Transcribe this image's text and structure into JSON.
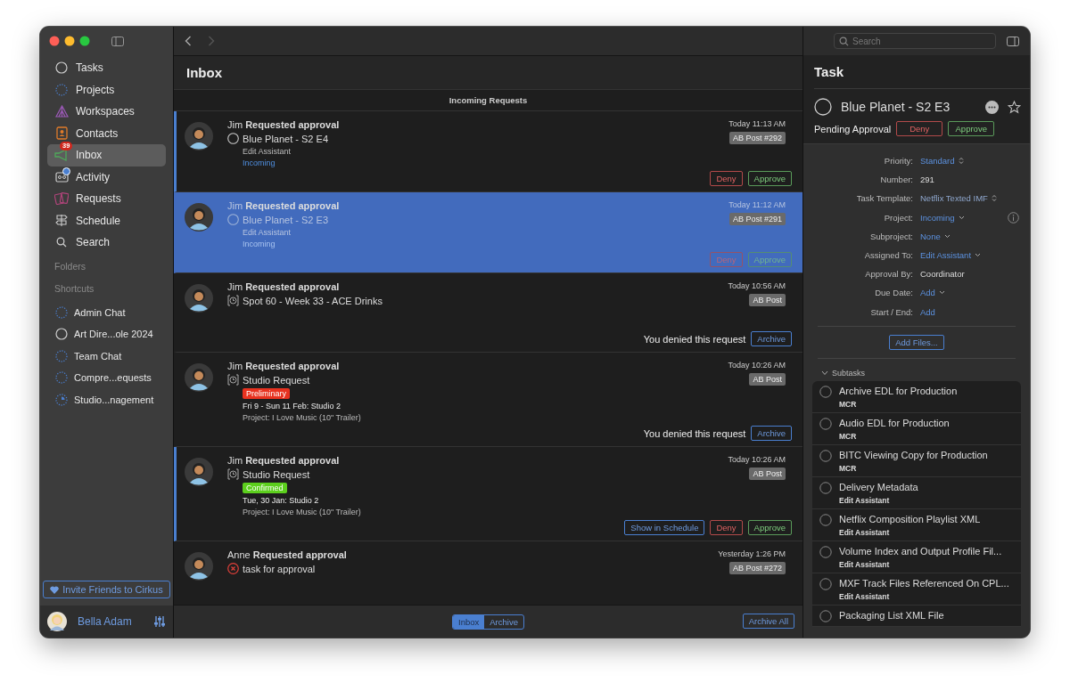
{
  "sidebar": {
    "nav": [
      {
        "label": "Tasks",
        "kind": "circle",
        "selected": false,
        "unread_dot": false
      },
      {
        "label": "Projects",
        "kind": "dotted",
        "selected": false,
        "unread_dot": false
      },
      {
        "label": "Workspaces",
        "kind": "tent",
        "selected": false,
        "unread_dot": false
      },
      {
        "label": "Contacts",
        "kind": "contacts",
        "selected": false,
        "unread_dot": false
      },
      {
        "label": "Inbox",
        "kind": "megaphone",
        "selected": true,
        "unread_dot": false,
        "badge": "39"
      },
      {
        "label": "Activity",
        "kind": "cassette",
        "selected": false,
        "unread_dot": true
      },
      {
        "label": "Requests",
        "kind": "cards",
        "selected": false,
        "unread_dot": false
      },
      {
        "label": "Schedule",
        "kind": "signpost",
        "selected": false,
        "unread_dot": false
      },
      {
        "label": "Search",
        "kind": "search",
        "selected": false,
        "unread_dot": false
      }
    ],
    "sections": [
      "Folders",
      "Shortcuts"
    ],
    "shortcuts": [
      {
        "label": "Admin Chat",
        "kind": "dotted"
      },
      {
        "label": "Art Dire...ole 2024",
        "kind": "circle"
      },
      {
        "label": "Team Chat",
        "kind": "dotted"
      },
      {
        "label": "Compre...equests",
        "kind": "dotted"
      },
      {
        "label": "Studio...nagement",
        "kind": "pie"
      }
    ],
    "invite_button": "Invite Friends to Cirkus",
    "user": {
      "name": "Bella Adam"
    }
  },
  "inbox": {
    "title": "Inbox",
    "section": "Incoming Requests",
    "items": [
      {
        "author": "Jim **Requested approval**",
        "time": "Today 11:13 AM",
        "tag": "AB Post #292",
        "title": "Blue Planet - S2 E4",
        "kind": "task",
        "subtitle": "Edit Assistant",
        "link": "Incoming",
        "unread": true,
        "selected": false,
        "buttons": [
          {
            "label": "Deny",
            "kind": "deny"
          },
          {
            "label": "Approve",
            "kind": "approve"
          }
        ]
      },
      {
        "author": "Jim **Requested approval**",
        "time": "Today 11:12 AM",
        "tag": "AB Post #291",
        "title": "Blue Planet - S2 E3",
        "kind": "task",
        "subtitle": "Edit Assistant",
        "link": "Incoming",
        "unread": false,
        "selected": true,
        "buttons": [
          {
            "label": "Deny",
            "kind": "deny"
          },
          {
            "label": "Approve",
            "kind": "approve"
          }
        ]
      },
      {
        "author": "Jim **Requested approval**",
        "time": "Today 10:56 AM",
        "tag": "AB Post",
        "title": "Spot 60 - Week 33 - ACE Drinks",
        "kind": "booking",
        "unread": false,
        "selected": false,
        "note": "You denied this request",
        "buttons": [
          {
            "label": "Archive",
            "kind": "neutral"
          }
        ]
      },
      {
        "author": "Jim **Requested approval**",
        "time": "Today 10:26 AM",
        "tag": "AB Post",
        "title": "Studio Request",
        "kind": "booking",
        "status": {
          "label": "Preliminary",
          "color": "#e8321f"
        },
        "dates": "Fri 9 - Sun 11 Feb: Studio 2",
        "project": "Project: I Love Music (10\" Trailer)",
        "unread": false,
        "selected": false,
        "note": "You denied this request",
        "buttons": [
          {
            "label": "Archive",
            "kind": "neutral"
          }
        ]
      },
      {
        "author": "Jim **Requested approval**",
        "time": "Today 10:26 AM",
        "tag": "AB Post",
        "title": "Studio Request",
        "kind": "booking",
        "status": {
          "label": "Confirmed",
          "color": "#5ccf1d"
        },
        "dates": "Tue, 30 Jan: Studio 2",
        "project": "Project: I Love Music (10\" Trailer)",
        "unread": true,
        "selected": false,
        "buttons": [
          {
            "label": "Show in Schedule",
            "kind": "neutral"
          },
          {
            "label": "Deny",
            "kind": "deny"
          },
          {
            "label": "Approve",
            "kind": "approve"
          }
        ]
      },
      {
        "author": "Anne **Requested approval**",
        "time": "Yesterday 1:26 PM",
        "tag": "AB Post #272",
        "title": "task for approval",
        "kind": "failed",
        "unread": false,
        "selected": false
      }
    ],
    "tabs": [
      {
        "label": "Inbox",
        "selected": true
      },
      {
        "label": "Archive",
        "selected": false
      }
    ],
    "archive_all": "Archive All"
  },
  "task": {
    "search": {
      "placeholder": "Search"
    },
    "heading": "Task",
    "title": "Blue Planet - S2 E3",
    "starred": false,
    "status": "Pending Approval",
    "buttons": [
      {
        "label": "Deny",
        "kind": "deny"
      },
      {
        "label": "Approve",
        "kind": "approve"
      }
    ],
    "fields": [
      {
        "label": "Priority:",
        "value": "Standard",
        "kind": "stepper",
        "info": false
      },
      {
        "label": "Number:",
        "value": "291",
        "kind": "plain",
        "info": false
      },
      {
        "label": "Task Template:",
        "value": "Netflix Texted IMF",
        "kind": "template",
        "info": false
      },
      {
        "label": "Project:",
        "value": "Incoming",
        "kind": "dropdown",
        "info": true
      },
      {
        "label": "Subproject:",
        "value": "None",
        "kind": "dropdown",
        "info": false
      },
      {
        "label": "Assigned To:",
        "value": "Edit Assistant",
        "kind": "dropdown",
        "info": false
      },
      {
        "label": "Approval By:",
        "value": "Coordinator",
        "kind": "plain",
        "info": false
      },
      {
        "label": "Due Date:",
        "value": "Add",
        "kind": "dropdown",
        "info": false
      },
      {
        "label": "Start / End:",
        "value": "Add",
        "kind": "link",
        "info": false
      }
    ],
    "add_files": "Add Files...",
    "subtasks": {
      "label": "Subtasks",
      "expanded": true,
      "items": [
        {
          "title": "Archive EDL for Production",
          "assignee": "MCR"
        },
        {
          "title": "Audio EDL for Production",
          "assignee": "MCR"
        },
        {
          "title": "BITC Viewing Copy for Production",
          "assignee": "MCR"
        },
        {
          "title": "Delivery Metadata",
          "assignee": "Edit Assistant"
        },
        {
          "title": "Netflix Composition Playlist XML",
          "assignee": "Edit Assistant"
        },
        {
          "title": "Volume Index and Output Profile Fil...",
          "assignee": "Edit Assistant"
        },
        {
          "title": "MXF Track Files Referenced On CPL...",
          "assignee": "Edit Assistant"
        },
        {
          "title": "Packaging List XML File"
        }
      ]
    }
  }
}
